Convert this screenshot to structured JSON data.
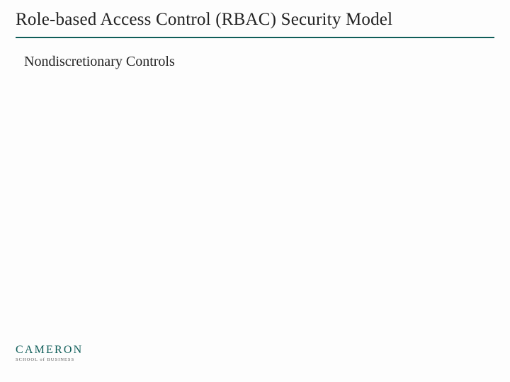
{
  "title": "Role-based Access Control (RBAC) Security Model",
  "body": "Nondiscretionary Controls",
  "logo": {
    "main": "CAMERON",
    "sub": "SCHOOL of BUSINESS"
  },
  "colors": {
    "accent": "#0f5d59"
  }
}
